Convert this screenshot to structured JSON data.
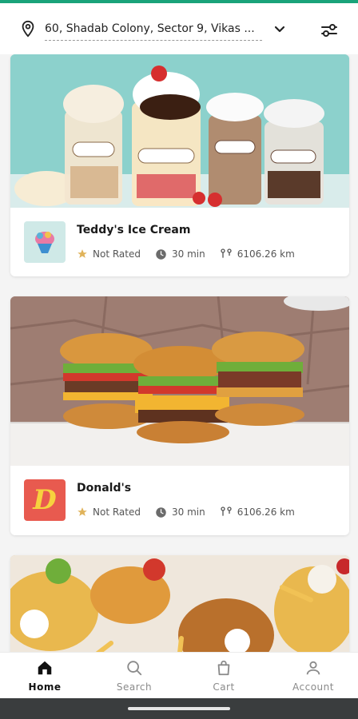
{
  "header": {
    "address": "60, Shadab Colony, Sector 9, Vikas ...",
    "location_icon": "location-pin-icon",
    "dropdown_icon": "chevron-down-icon",
    "filter_icon": "filter-sliders-icon"
  },
  "restaurants": [
    {
      "name": "Teddy's Ice Cream",
      "rating": "Not Rated",
      "time": "30 min",
      "distance": "6106.26 km",
      "image": "ice-cream-sundaes-photo",
      "logo": "ice-cream-logo"
    },
    {
      "name": "Donald's",
      "rating": "Not Rated",
      "time": "30 min",
      "distance": "6106.26 km",
      "image": "burgers-photo",
      "logo": "donalds-d-logo",
      "logo_letter": "D"
    },
    {
      "image": "fried-chicken-platter-photo"
    }
  ],
  "nav": {
    "items": [
      {
        "label": "Home",
        "icon": "home-icon",
        "active": true
      },
      {
        "label": "Search",
        "icon": "search-icon",
        "active": false
      },
      {
        "label": "Cart",
        "icon": "cart-icon",
        "active": false
      },
      {
        "label": "Account",
        "icon": "account-icon",
        "active": false
      }
    ]
  },
  "colors": {
    "accent": "#1aa37a",
    "star": "#e0b35a",
    "donalds_logo_bg": "#e85a4f",
    "donalds_logo_letter": "#f7d23e",
    "teddys_logo_bg": "#cfe9e7"
  }
}
